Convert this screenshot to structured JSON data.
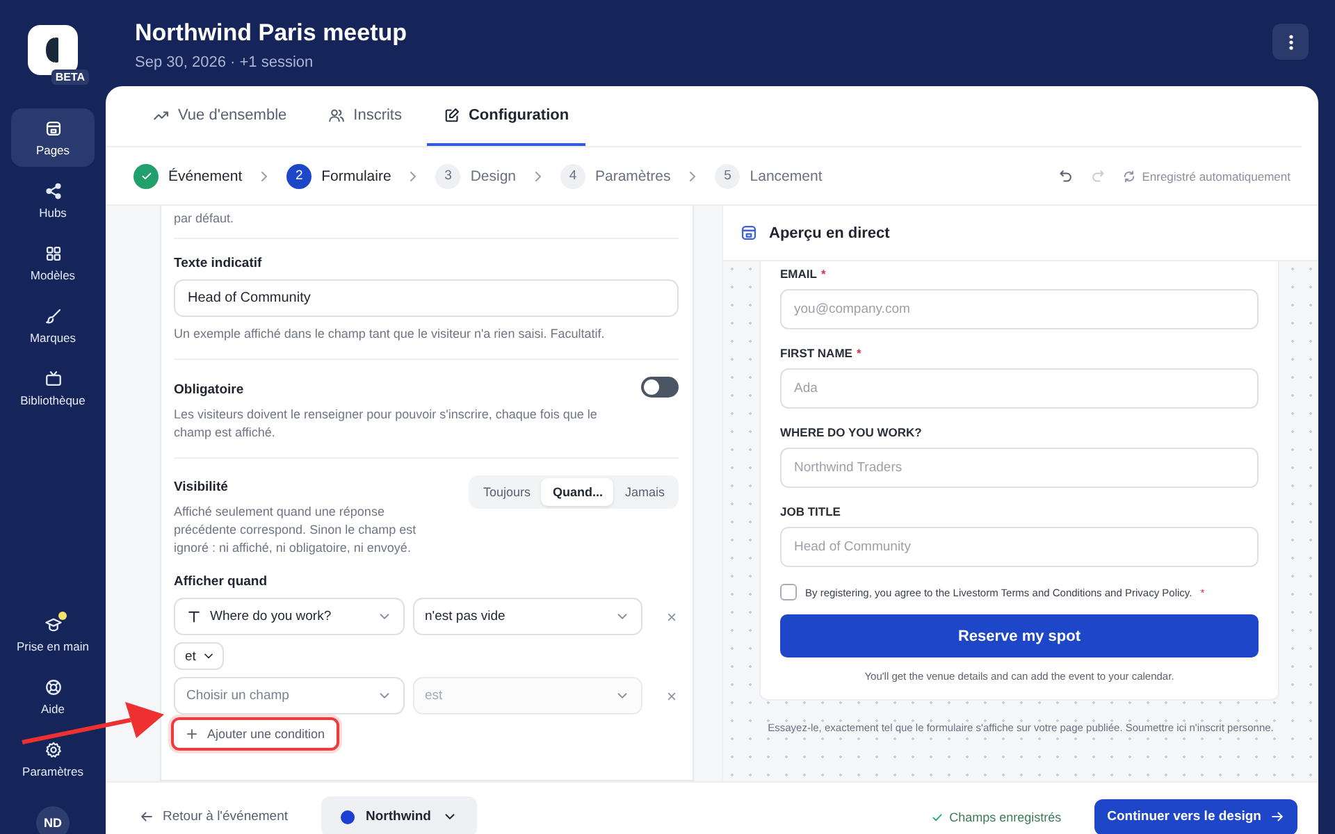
{
  "app": {
    "badge": "BETA"
  },
  "sidebar": {
    "items": [
      {
        "label": "Pages",
        "selected": true
      },
      {
        "label": "Hubs",
        "selected": false
      },
      {
        "label": "Modèles",
        "selected": false
      },
      {
        "label": "Marques",
        "selected": false
      },
      {
        "label": "Bibliothèque",
        "selected": false
      }
    ],
    "bottom_items": [
      {
        "label": "Prise en main",
        "notification": true
      },
      {
        "label": "Aide",
        "notification": false
      },
      {
        "label": "Paramètres",
        "notification": false
      }
    ],
    "avatar": "ND"
  },
  "header": {
    "title": "Northwind Paris meetup",
    "subtitle": "Sep 30, 2026 · +1 session"
  },
  "tabs": [
    {
      "label": "Vue d'ensemble",
      "selected": false
    },
    {
      "label": "Inscrits",
      "selected": false
    },
    {
      "label": "Configuration",
      "selected": true
    }
  ],
  "stepper": {
    "steps": [
      {
        "label": "Événement",
        "kind": "done"
      },
      {
        "number": "2",
        "label": "Formulaire",
        "kind": "current"
      },
      {
        "number": "3",
        "label": "Design",
        "kind": "upcoming"
      },
      {
        "number": "4",
        "label": "Paramètres",
        "kind": "upcoming"
      },
      {
        "number": "5",
        "label": "Lancement",
        "kind": "upcoming"
      }
    ],
    "undo": {
      "disabled": false
    },
    "redo": {
      "disabled": true
    },
    "autosave": "Enregistré automatiquement"
  },
  "editor": {
    "cut_text": "par défaut.",
    "placeholder_setting": {
      "label": "Texte indicatif",
      "value": "Head of Community",
      "help": "Un exemple affiché dans le champ tant que le visiteur n'a rien saisi. Facultatif."
    },
    "required_setting": {
      "label": "Obligatoire",
      "on": false,
      "help": "Les visiteurs doivent le renseigner pour pouvoir s'inscrire, chaque fois que le champ est affiché."
    },
    "visibility": {
      "label": "Visibilité",
      "help": "Affiché seulement quand une réponse précédente correspond. Sinon le champ est ignoré : ni affiché, ni obligatoire, ni envoyé.",
      "options": [
        {
          "label": "Toujours",
          "selected": false
        },
        {
          "label": "Quand...",
          "selected": true
        },
        {
          "label": "Jamais",
          "selected": false
        }
      ]
    },
    "conditions": {
      "label": "Afficher quand",
      "rows": [
        {
          "kind": "filled",
          "field": "Where do you work?",
          "operator": "n'est pas vide"
        },
        {
          "kind": "empty",
          "field": "Choisir un champ",
          "operator": "est"
        }
      ],
      "joiner": "et",
      "add_button": {
        "label": "Ajouter une condition",
        "highlighted": true
      }
    }
  },
  "preview": {
    "title": "Aperçu en direct",
    "fields": [
      {
        "label": "EMAIL",
        "required_mark": "*",
        "placeholder": "you@company.com"
      },
      {
        "label": "FIRST NAME",
        "required_mark": "*",
        "placeholder": "Ada"
      },
      {
        "label": "WHERE DO YOU WORK?",
        "placeholder": "Northwind Traders"
      },
      {
        "label": "JOB TITLE",
        "placeholder": "Head of Community"
      }
    ],
    "consent": {
      "text": "By registering, you agree to the Livestorm Terms and Conditions and Privacy Policy.",
      "required_mark": "*",
      "checked": false
    },
    "submit": "Reserve my spot",
    "note": "You'll get the venue details and can add the event to your calendar.",
    "caption": "Essayez-le, exactement tel que le formulaire s'affiche sur votre page publiée. Soumettre ici n'inscrit personne."
  },
  "footer": {
    "back": "Retour à l'événement",
    "brand": {
      "label": "Northwind",
      "color": "#1d3fd1"
    },
    "saved": "Champs enregistrés",
    "continue": "Continuer vers le design"
  }
}
